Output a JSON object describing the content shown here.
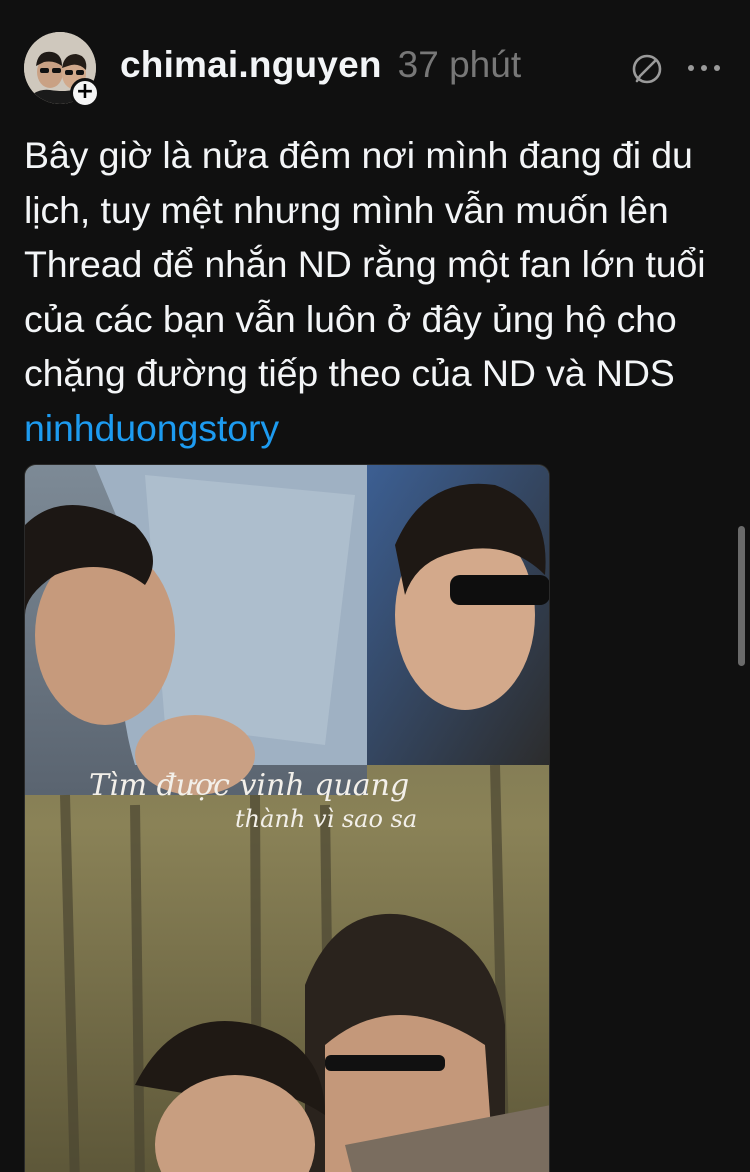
{
  "post": {
    "author": {
      "username": "chimai.nguyen",
      "avatar": "profile-photo",
      "follow_badge": "+"
    },
    "timestamp": "37 phút",
    "actions": {
      "thread_icon": "threads-quote-icon",
      "more_icon": "more-horizontal-icon"
    },
    "text": "Bây giờ là nửa đêm nơi mình đang đi du lịch, tuy mệt nhưng mình vẫn muốn lên Thread để nhắn ND rằng một fan lớn tuổi của các bạn vẫn luôn ở đây ủng hộ cho chặng đường tiếp theo của ND và NDS",
    "hashtag": "ninhduongstory",
    "media": {
      "caption_line1": "Tìm được vinh quang",
      "caption_line2": "thành vì sao sa"
    }
  },
  "colors": {
    "background": "#101010",
    "text": "#f3f5f7",
    "muted": "#777777",
    "link": "#1d9bf0"
  }
}
